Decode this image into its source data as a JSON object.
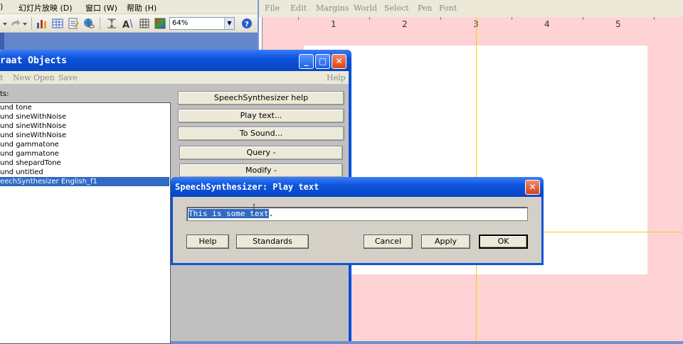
{
  "ppt": {
    "menus": [
      ")",
      "幻灯片放映 (D)",
      "窗口 (W)",
      "帮助 (H)"
    ],
    "zoom_value": "64%",
    "toolbar_icons": [
      "undo-icon",
      "redo-icon",
      "chart-icon",
      "table-icon",
      "word-doc-icon",
      "hyperlink-icon",
      "expand-icon",
      "font-size-icon",
      "grid-icon",
      "color-icon",
      "help-icon"
    ]
  },
  "picture": {
    "menus": [
      "File",
      "Edit",
      "Margins",
      "World",
      "Select",
      "Pen",
      "Font"
    ],
    "ruler": [
      "1",
      "2",
      "3",
      "4",
      "5"
    ]
  },
  "objects": {
    "title": "raat Objects",
    "menus": [
      "t",
      "New",
      "Open",
      "Save"
    ],
    "help_menu": "Help",
    "list_label": "ts:",
    "items": [
      "und tone",
      "und sineWithNoise",
      "und sineWithNoise",
      "und sineWithNoise",
      "und gammatone",
      "und gammatone",
      "und shepardTone",
      "und untitled",
      "eechSynthesizer English_f1"
    ],
    "selected_index": 8,
    "buttons": [
      "SpeechSynthesizer help",
      "Play text...",
      "To Sound...",
      "Query -",
      "Modify -"
    ]
  },
  "dialog": {
    "title": "SpeechSynthesizer: Play text",
    "input_selected": "This is some text",
    "input_rest": ".",
    "help": "Help",
    "standards": "Standards",
    "cancel": "Cancel",
    "apply": "Apply",
    "ok": "OK"
  },
  "colors": {
    "title_bar": "#0c52dc",
    "selection": "#316ac5",
    "margin_pink": "#ffd3d6",
    "guide_yellow": "#f2d000",
    "face": "#d4d0c8"
  }
}
